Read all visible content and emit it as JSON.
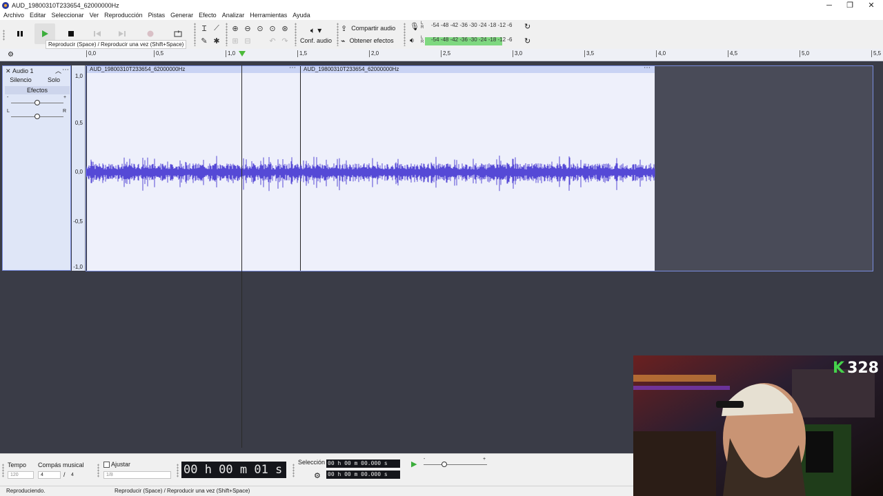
{
  "window": {
    "title": "AUD_19800310T233654_62000000Hz",
    "controls": {
      "minimize": "─",
      "maximize": "❐",
      "close": "✕"
    }
  },
  "menu": [
    "Archivo",
    "Editar",
    "Seleccionar",
    "Ver",
    "Reproducción",
    "Pistas",
    "Generar",
    "Efecto",
    "Analizar",
    "Herramientas",
    "Ayuda"
  ],
  "toolbar": {
    "tooltip": "Reproducir (Space) / Reproducir una vez (Shift+Space)",
    "audio_setup": "Conf. audio",
    "share_audio": "Compartir audio",
    "get_effects": "Obtener efectos",
    "meter_record": "-54 -48 -42 -36 -30 -24 -18 -12 -6",
    "meter_play": "-54 -48 -42 -36 -30 -24 -18 -12 -6",
    "meter_record_lr": "L R",
    "meter_play_lr": "L R"
  },
  "ruler": {
    "ticks": [
      "0,0",
      "0,5",
      "1,0",
      "1,5",
      "2,0",
      "2,5",
      "3,0",
      "3,5",
      "4,0",
      "4,5",
      "5,0",
      "5,5"
    ]
  },
  "track": {
    "name": "Audio 1",
    "close": "✕",
    "collapse": "︿",
    "menu": "⋯",
    "mute": "Silencio",
    "solo": "Solo",
    "effects": "Efectos",
    "gain_minus": "-",
    "gain_plus": "+",
    "pan_left": "L",
    "pan_right": "R",
    "gain_level": 0.5,
    "pan_level": 0.5,
    "amplitude_labels": [
      "1,0",
      "0,5",
      "0,0",
      "-0,5",
      "-1,0"
    ]
  },
  "clips": [
    {
      "name": "AUD_19800310T233654_62000000Hz",
      "menu": "⋯"
    },
    {
      "name": "AUD_19800310T233654_62000000Hz",
      "menu": "⋯"
    }
  ],
  "playback_position_seconds": 1.08,
  "colors": {
    "waveform": "#5549d6",
    "playhead": "#4cba3a",
    "clip_background": "#eef0fb",
    "track_background": "#494b58"
  },
  "bottom": {
    "tempo_label": "Tempo",
    "tempo_value": "120",
    "time_signature_label": "Compás musical",
    "time_sig_num": "4",
    "time_sig_sep": "/",
    "time_sig_den": "4",
    "snap_label": "Ajustar",
    "snap_value": "1/8",
    "time_display": "00 h 00 m 01 s",
    "selection_label": "Selección",
    "selection_start": "00 h 00 m 00.000 s",
    "selection_end": "00 h 00 m 00.000 s",
    "speed_minus": "-",
    "speed_plus": "+"
  },
  "status": {
    "left": "Reproduciendo.",
    "center": "Reproducir (Space) / Reproducir una vez (Shift+Space)"
  },
  "webcam": {
    "badge_letter": "K",
    "badge_number": "328"
  }
}
